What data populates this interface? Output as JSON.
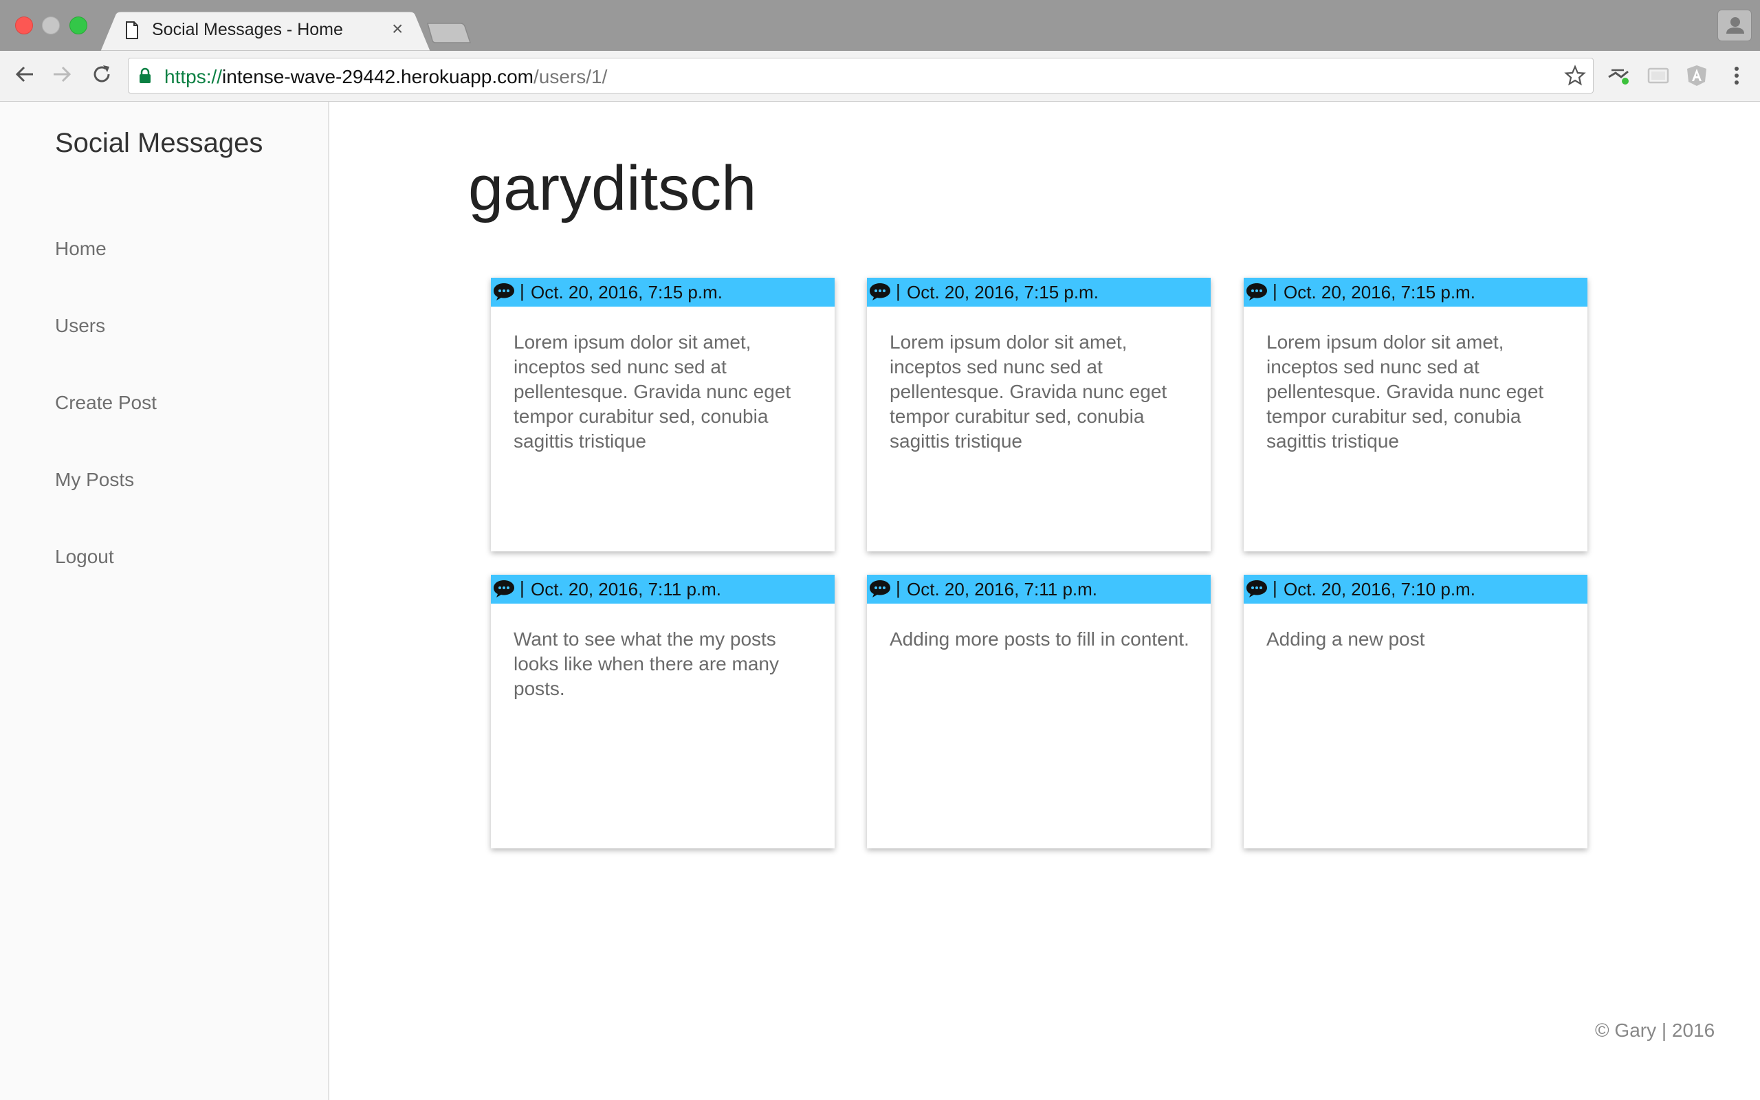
{
  "browser": {
    "tab_title": "Social Messages - Home",
    "tab_close": "×",
    "url_scheme": "https://",
    "url_host": "intense-wave-29442.herokuapp.com",
    "url_path": "/users/1/"
  },
  "sidebar": {
    "brand": "Social Messages",
    "items": [
      {
        "label": "Home"
      },
      {
        "label": "Users"
      },
      {
        "label": "Create Post"
      },
      {
        "label": "My Posts"
      },
      {
        "label": "Logout"
      }
    ]
  },
  "main": {
    "username": "garyditsch",
    "separator": "|",
    "posts": [
      {
        "date": "Oct. 20, 2016, 7:15 p.m.",
        "text": "Lorem ipsum dolor sit amet, inceptos sed nunc sed at pellentesque. Gravida nunc eget tempor curabitur sed, conubia sagittis tristique"
      },
      {
        "date": "Oct. 20, 2016, 7:15 p.m.",
        "text": "Lorem ipsum dolor sit amet, inceptos sed nunc sed at pellentesque. Gravida nunc eget tempor curabitur sed, conubia sagittis tristique"
      },
      {
        "date": "Oct. 20, 2016, 7:15 p.m.",
        "text": "Lorem ipsum dolor sit amet, inceptos sed nunc sed at pellentesque. Gravida nunc eget tempor curabitur sed, conubia sagittis tristique"
      },
      {
        "date": "Oct. 20, 2016, 7:11 p.m.",
        "text": "Want to see what the my posts looks like when there are many posts."
      },
      {
        "date": "Oct. 20, 2016, 7:11 p.m.",
        "text": "Adding more posts to fill in content."
      },
      {
        "date": "Oct. 20, 2016, 7:10 p.m.",
        "text": "Adding a new post"
      }
    ]
  },
  "footer": {
    "text": "© Gary | 2016"
  },
  "colors": {
    "card_header": "#40c4ff",
    "sidebar_bg": "#fafafa",
    "secure_scheme": "#0b8043"
  }
}
